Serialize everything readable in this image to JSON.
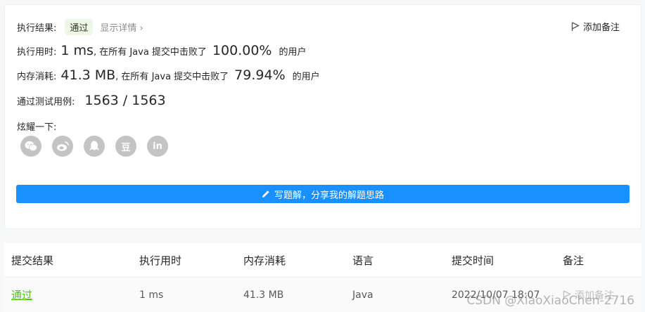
{
  "result": {
    "label": "执行结果:",
    "status": "通过",
    "details_link": "显示详情 ›",
    "add_note": "添加备注"
  },
  "runtime": {
    "label": "执行用时:",
    "value": "1 ms",
    "prefix": ", 在所有 Java 提交中击败了",
    "percent": "100.00%",
    "suffix": "的用户"
  },
  "memory": {
    "label": "内存消耗:",
    "value": "41.3 MB",
    "prefix": ", 在所有 Java 提交中击败了",
    "percent": "79.94%",
    "suffix": "的用户"
  },
  "tests": {
    "label": "通过测试用例:",
    "value": "1563 / 1563"
  },
  "share": {
    "label": "炫耀一下:",
    "buttons": [
      {
        "icon": "wechat-icon"
      },
      {
        "icon": "weibo-icon"
      },
      {
        "icon": "qq-icon"
      },
      {
        "icon": "douban-icon",
        "text": "豆"
      },
      {
        "icon": "linkedin-icon",
        "text": "in"
      }
    ]
  },
  "write_solution": {
    "label": "写题解，分享我的解题思路",
    "color": "#1890ff"
  },
  "table": {
    "headers": [
      "提交结果",
      "执行用时",
      "内存消耗",
      "语言",
      "提交时间",
      "备注"
    ],
    "rows": [
      {
        "result": "通过",
        "runtime": "1 ms",
        "memory": "41.3 MB",
        "language": "Java",
        "time": "2022/10/07 18:07",
        "note": "添加备注"
      }
    ]
  },
  "watermark": "CSDN @XiaoXiaoChen-2716",
  "colors": {
    "accepted": "#52c41a",
    "badge_bg": "#eef8e6",
    "share_icon": "#c4c4c4"
  }
}
